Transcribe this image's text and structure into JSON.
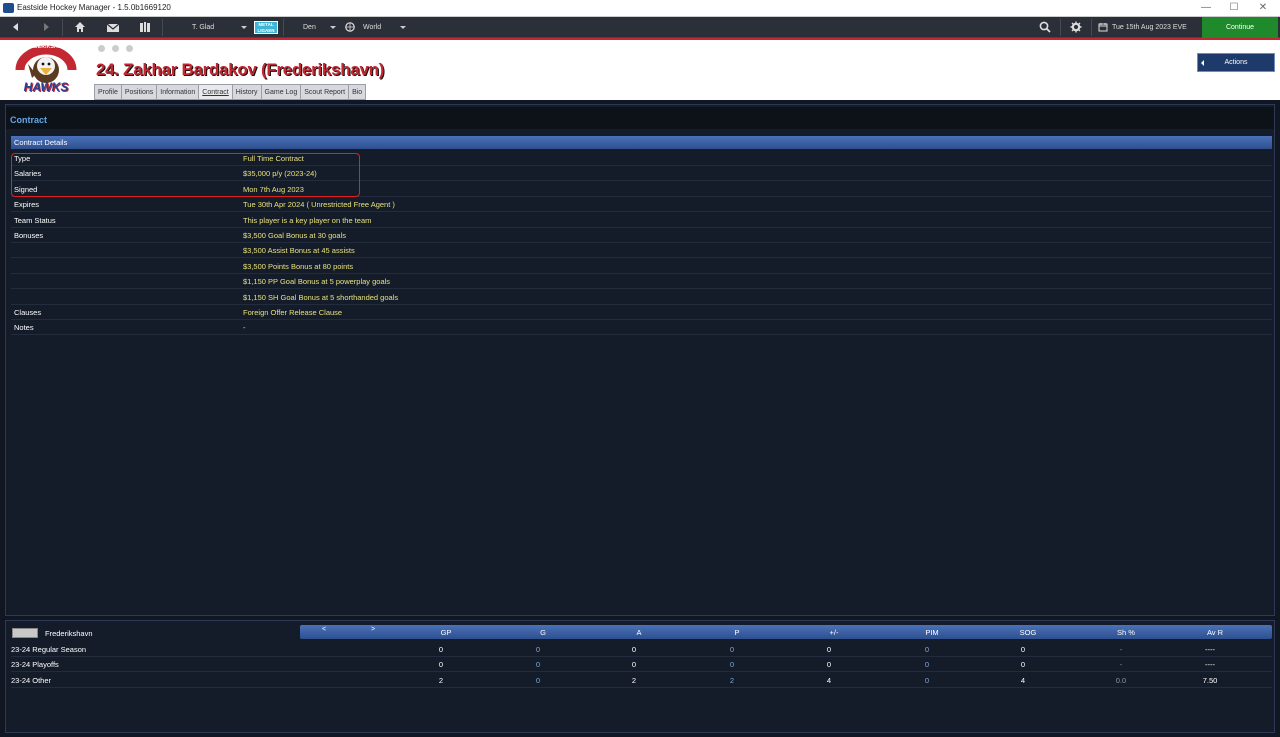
{
  "window": {
    "title": "Eastside Hockey Manager - 1.5.0b1669120",
    "controls": [
      "—",
      "☐",
      "✕"
    ]
  },
  "toolbar": {
    "manager_name": "T. Glad",
    "league_badge": "METAL LIGAEN",
    "country_dropdown": "Den",
    "scope_dropdown": "World",
    "date_text": "Tue 15th Aug 2023 EVE",
    "continue_label": "Continue"
  },
  "header": {
    "team_logo_text": "FREDERIKSHAVN",
    "team_logo_subtext": "HAWKS",
    "player_title": "24. Zakhar Bardakov (Frederikshavn)",
    "actions_label": "Actions",
    "tabs": [
      {
        "label": "Profile",
        "active": false
      },
      {
        "label": "Positions",
        "active": false
      },
      {
        "label": "Information",
        "active": false
      },
      {
        "label": "Contract",
        "active": true
      },
      {
        "label": "History",
        "active": false
      },
      {
        "label": "Game Log",
        "active": false
      },
      {
        "label": "Scout Report",
        "active": false
      },
      {
        "label": "Bio",
        "active": false
      }
    ]
  },
  "contract": {
    "section_title": "Contract",
    "subsection_title": "Contract Details",
    "rows": [
      {
        "label": "Type",
        "value": "Full Time Contract"
      },
      {
        "label": "Salaries",
        "value": "$35,000 p/y (2023-24)"
      },
      {
        "label": "Signed",
        "value": "Mon 7th Aug 2023"
      },
      {
        "label": "Expires",
        "value": "Tue 30th Apr 2024 ( Unrestricted Free Agent )"
      },
      {
        "label": "Team Status",
        "value": "This player is a key player on the team"
      },
      {
        "label": "Bonuses",
        "value": "$3,500 Goal Bonus at 30 goals"
      },
      {
        "label": "",
        "value": "$3,500 Assist Bonus at 45 assists"
      },
      {
        "label": "",
        "value": "$3,500 Points Bonus at 80 points"
      },
      {
        "label": "",
        "value": "$1,150 PP Goal Bonus at 5 powerplay goals"
      },
      {
        "label": "",
        "value": "$1,150 SH Goal Bonus at 5 shorthanded goals"
      },
      {
        "label": "Clauses",
        "value": "Foreign Offer Release Clause"
      },
      {
        "label": "Notes",
        "value": "-"
      }
    ]
  },
  "stats": {
    "team_name": "Frederikshavn",
    "nav_prev": "<",
    "nav_next": ">",
    "columns": [
      "GP",
      "G",
      "A",
      "P",
      "+/-",
      "PIM",
      "SOG",
      "Sh %",
      "Av R"
    ],
    "rows": [
      {
        "label": "23-24 Regular Season",
        "cells": [
          "0",
          "0",
          "0",
          "0",
          "0",
          "0",
          "0",
          "-",
          "----"
        ]
      },
      {
        "label": "23-24 Playoffs",
        "cells": [
          "0",
          "0",
          "0",
          "0",
          "0",
          "0",
          "0",
          "-",
          "----"
        ]
      },
      {
        "label": "23-24 Other",
        "cells": [
          "2",
          "0",
          "2",
          "2",
          "4",
          "0",
          "4",
          "0.0",
          "7.50"
        ]
      }
    ]
  }
}
